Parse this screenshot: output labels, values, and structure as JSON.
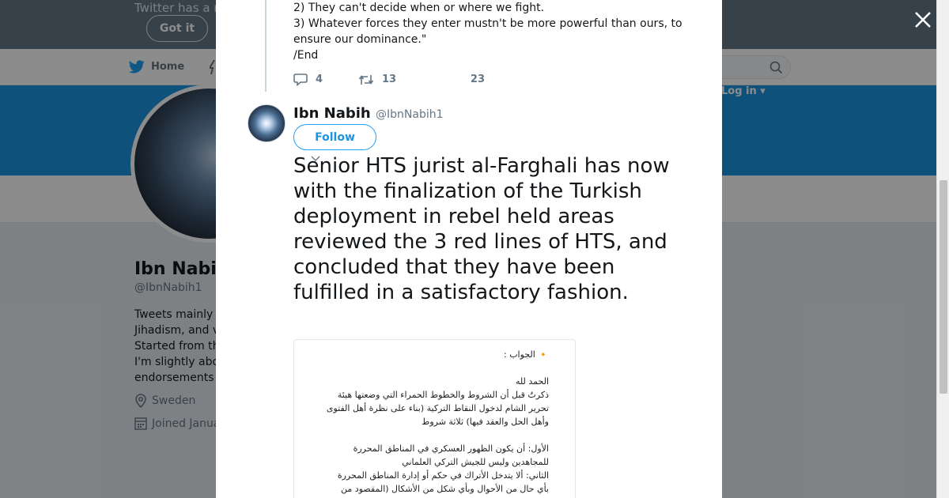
{
  "background": {
    "notice_text": "Twitter has a n",
    "got_it_label": "Got it",
    "nav_home_label": "Home",
    "login_label": "Log in",
    "profile": {
      "name": "Ibn Nabil",
      "handle": "@IbnNabih1",
      "bio_lines": [
        "Tweets mainly",
        "Jihadism, and v",
        "Started from th",
        "I'm slightly abo",
        "endorsements"
      ],
      "location": "Sweden",
      "joined": "Joined Janua"
    }
  },
  "modal": {
    "previous_tweet_lines": [
      "2) They can't decide when or where we fight.",
      "3) Whatever forces they enter mustn't be more powerful than ours, to",
      "ensure our dominance.\"",
      "/End"
    ],
    "actions": {
      "replies": "4",
      "retweets": "13",
      "likes": "23"
    },
    "author": {
      "name": "Ibn Nabih",
      "handle": "@IbnNabih1"
    },
    "follow_label": "Follow",
    "tweet_text": "Senior HTS jurist al-Farghali has now with the finalization of the Turkish deployment in rebel held areas reviewed the 3 red lines of HTS, and concluded that they have been fulfilled in a satisfactory fashion.",
    "image_text_lines": [
      "🔸 الجواب :",
      "",
      "الحمد لله",
      "ذكرتُ قبل أن الشروط والخطوط الحمراء التي وضعتها هيئة",
      "تحرير الشام لدخول النقاط التركية (بناء على نظرة أهل الفتوى",
      "وأهل الحل والعقد فيها) ثلاثة شروط",
      "",
      "الأول: أن يكون الظهور العسكري في المناطق المحررة",
      "للمجاهدين وليس للجيش التركي العلماني",
      "الثاني: ألا يتدخل الأتراك في حكم أو إدارة المناطق المحررة",
      "بأي حال من الأحوال وبأي شكل من الأشكال (المقصود من"
    ]
  },
  "colors": {
    "twitter_blue": "#1da1f2",
    "banner_blue": "#1b95e0",
    "notice_gray": "#657786"
  }
}
